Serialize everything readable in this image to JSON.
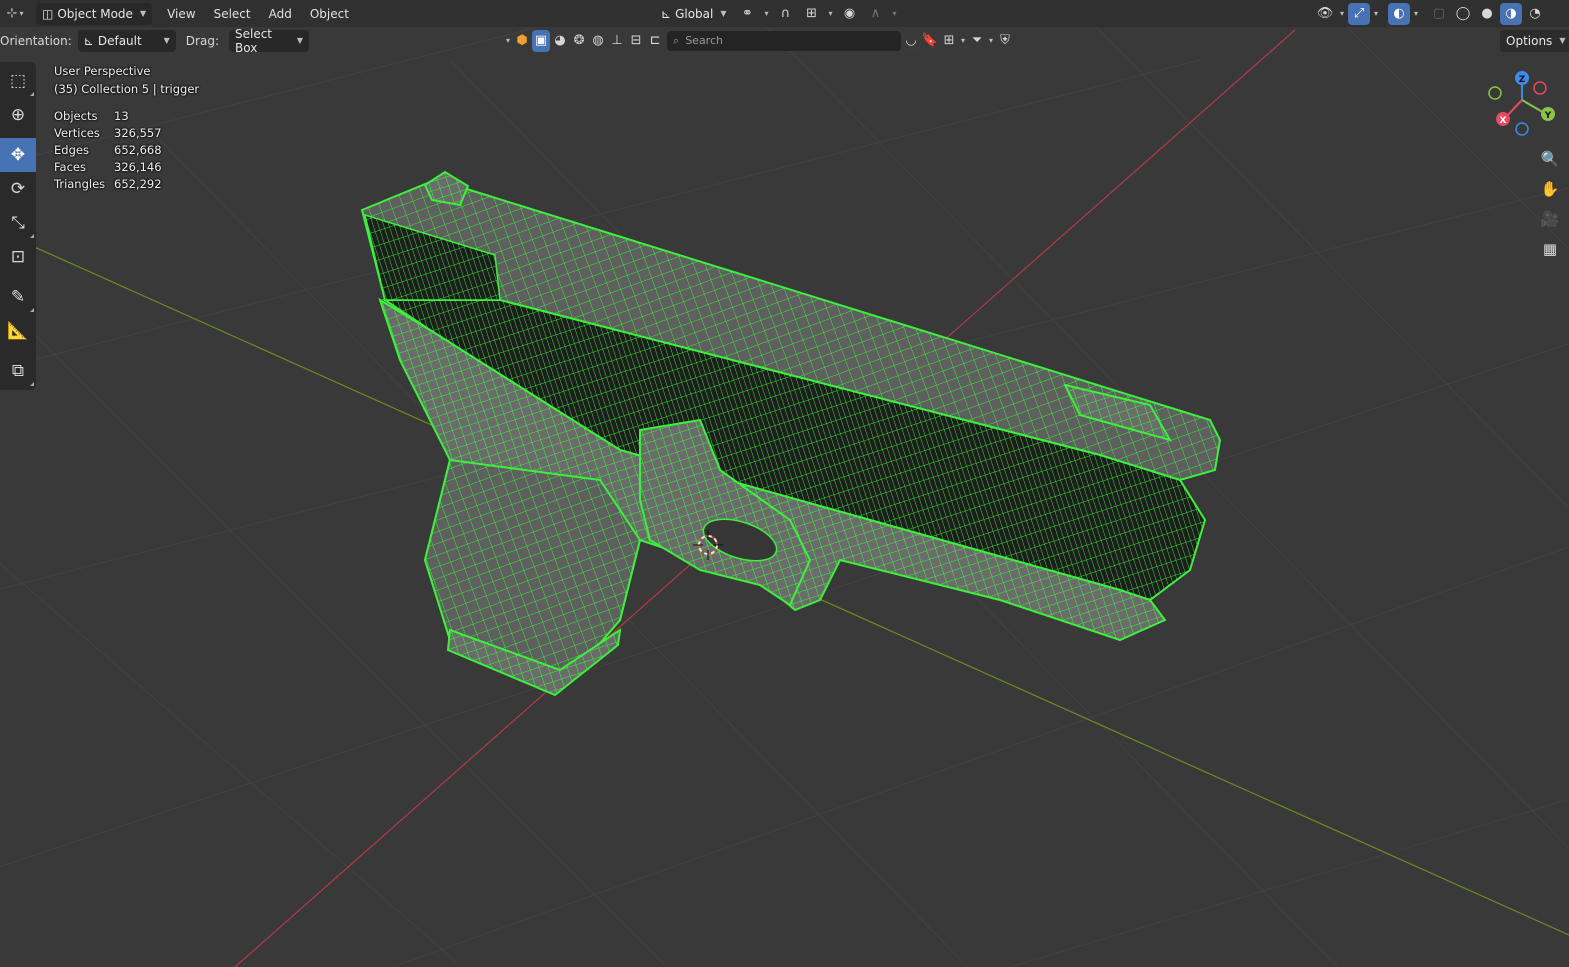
{
  "header": {
    "mode_label": "Object Mode",
    "menus": [
      "View",
      "Select",
      "Add",
      "Object"
    ],
    "transform_orientation": "Global",
    "snapping_icon": "magnet-icon",
    "proportional_icon": "circle-dot-icon"
  },
  "tool_header": {
    "orientation_label": "Orientation:",
    "orientation_value": "Default",
    "drag_label": "Drag:",
    "drag_value": "Select Box",
    "search_placeholder": "Search",
    "options_label": "Options"
  },
  "overlay": {
    "view_name": "User Perspective",
    "collection_info": "(35) Collection 5 | trigger",
    "stats": [
      {
        "label": "Objects",
        "value": "13"
      },
      {
        "label": "Vertices",
        "value": "326,557"
      },
      {
        "label": "Edges",
        "value": "652,668"
      },
      {
        "label": "Faces",
        "value": "326,146"
      },
      {
        "label": "Triangles",
        "value": "652,292"
      }
    ]
  },
  "gizmo": {
    "x_label": "X",
    "y_label": "Y",
    "z_label": "Z",
    "x_color": "#e84a5f",
    "y_color": "#8bc34a",
    "z_color": "#3d8be8"
  },
  "colors": {
    "viewport_bg": "#393939",
    "grid": "#444444",
    "x_axis": "#b23a48",
    "y_axis": "#6a8c1f",
    "wire": "#3cf03c",
    "accent": "#4772b3"
  }
}
